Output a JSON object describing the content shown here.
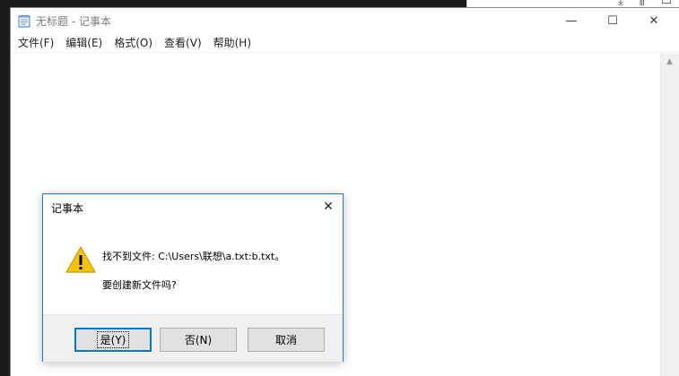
{
  "notepad": {
    "title": "无标题 - 记事本",
    "menu": [
      "文件(F)",
      "编辑(E)",
      "格式(O)",
      "查看(V)",
      "帮助(H)"
    ],
    "controls": {
      "minimize": "—",
      "maximize": "☐",
      "close": "✕"
    }
  },
  "dialog": {
    "title": "记事本",
    "close_label": "✕",
    "message_line1": "找不到文件: C:\\Users\\联想\\a.txt:b.txt。",
    "message_line2": "要创建新文件吗?",
    "buttons": {
      "yes": "是(Y)",
      "no": "否(N)",
      "cancel": "取消"
    },
    "icon": "warning-icon"
  },
  "colors": {
    "dialog_border": "#1979ca",
    "default_button_border": "#0078d7",
    "warning_yellow": "#f4c400"
  }
}
